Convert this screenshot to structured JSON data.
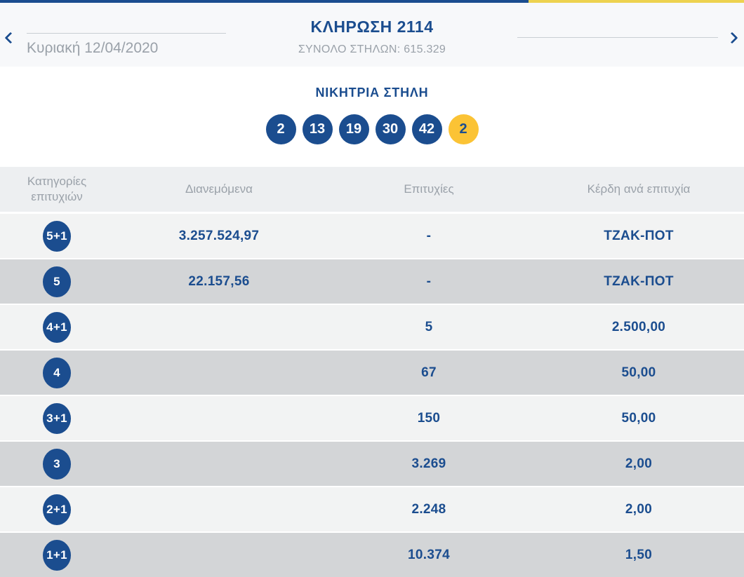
{
  "header": {
    "title": "ΚΛΗΡΩΣΗ 2114",
    "subtitle": "ΣΥΝΟΛΟ ΣΤΗΛΩΝ: 615.329",
    "date": "Κυριακή 12/04/2020"
  },
  "icons": {
    "prev": "chevron-left",
    "next": "chevron-right"
  },
  "winning_column": {
    "title": "ΝΙΚΗΤΡΙΑ ΣΤΗΛΗ",
    "numbers": [
      "2",
      "13",
      "19",
      "30",
      "42"
    ],
    "joker": "2"
  },
  "results_table": {
    "columns": [
      "Κατηγορίες επιτυχιών",
      "Διανεμόμενα",
      "Επιτυχίες",
      "Κέρδη ανά επιτυχία"
    ],
    "rows": [
      {
        "category": "5+1",
        "distributed": "3.257.524,97",
        "winners": "-",
        "prize": "ΤΖΑΚ-ΠΟΤ"
      },
      {
        "category": "5",
        "distributed": "22.157,56",
        "winners": "-",
        "prize": "ΤΖΑΚ-ΠΟΤ"
      },
      {
        "category": "4+1",
        "distributed": "",
        "winners": "5",
        "prize": "2.500,00"
      },
      {
        "category": "4",
        "distributed": "",
        "winners": "67",
        "prize": "50,00"
      },
      {
        "category": "3+1",
        "distributed": "",
        "winners": "150",
        "prize": "50,00"
      },
      {
        "category": "3",
        "distributed": "",
        "winners": "3.269",
        "prize": "2,00"
      },
      {
        "category": "2+1",
        "distributed": "",
        "winners": "2.248",
        "prize": "2,00"
      },
      {
        "category": "1+1",
        "distributed": "",
        "winners": "10.374",
        "prize": "1,50"
      }
    ]
  },
  "colors": {
    "brand_blue": "#1b4d8f",
    "brand_yellow": "#fbc335",
    "top_border_yellow": "#edd24f",
    "row_light": "#f2f3f3",
    "row_dark": "#d3d5d7",
    "muted_text": "#9aa1a9"
  }
}
